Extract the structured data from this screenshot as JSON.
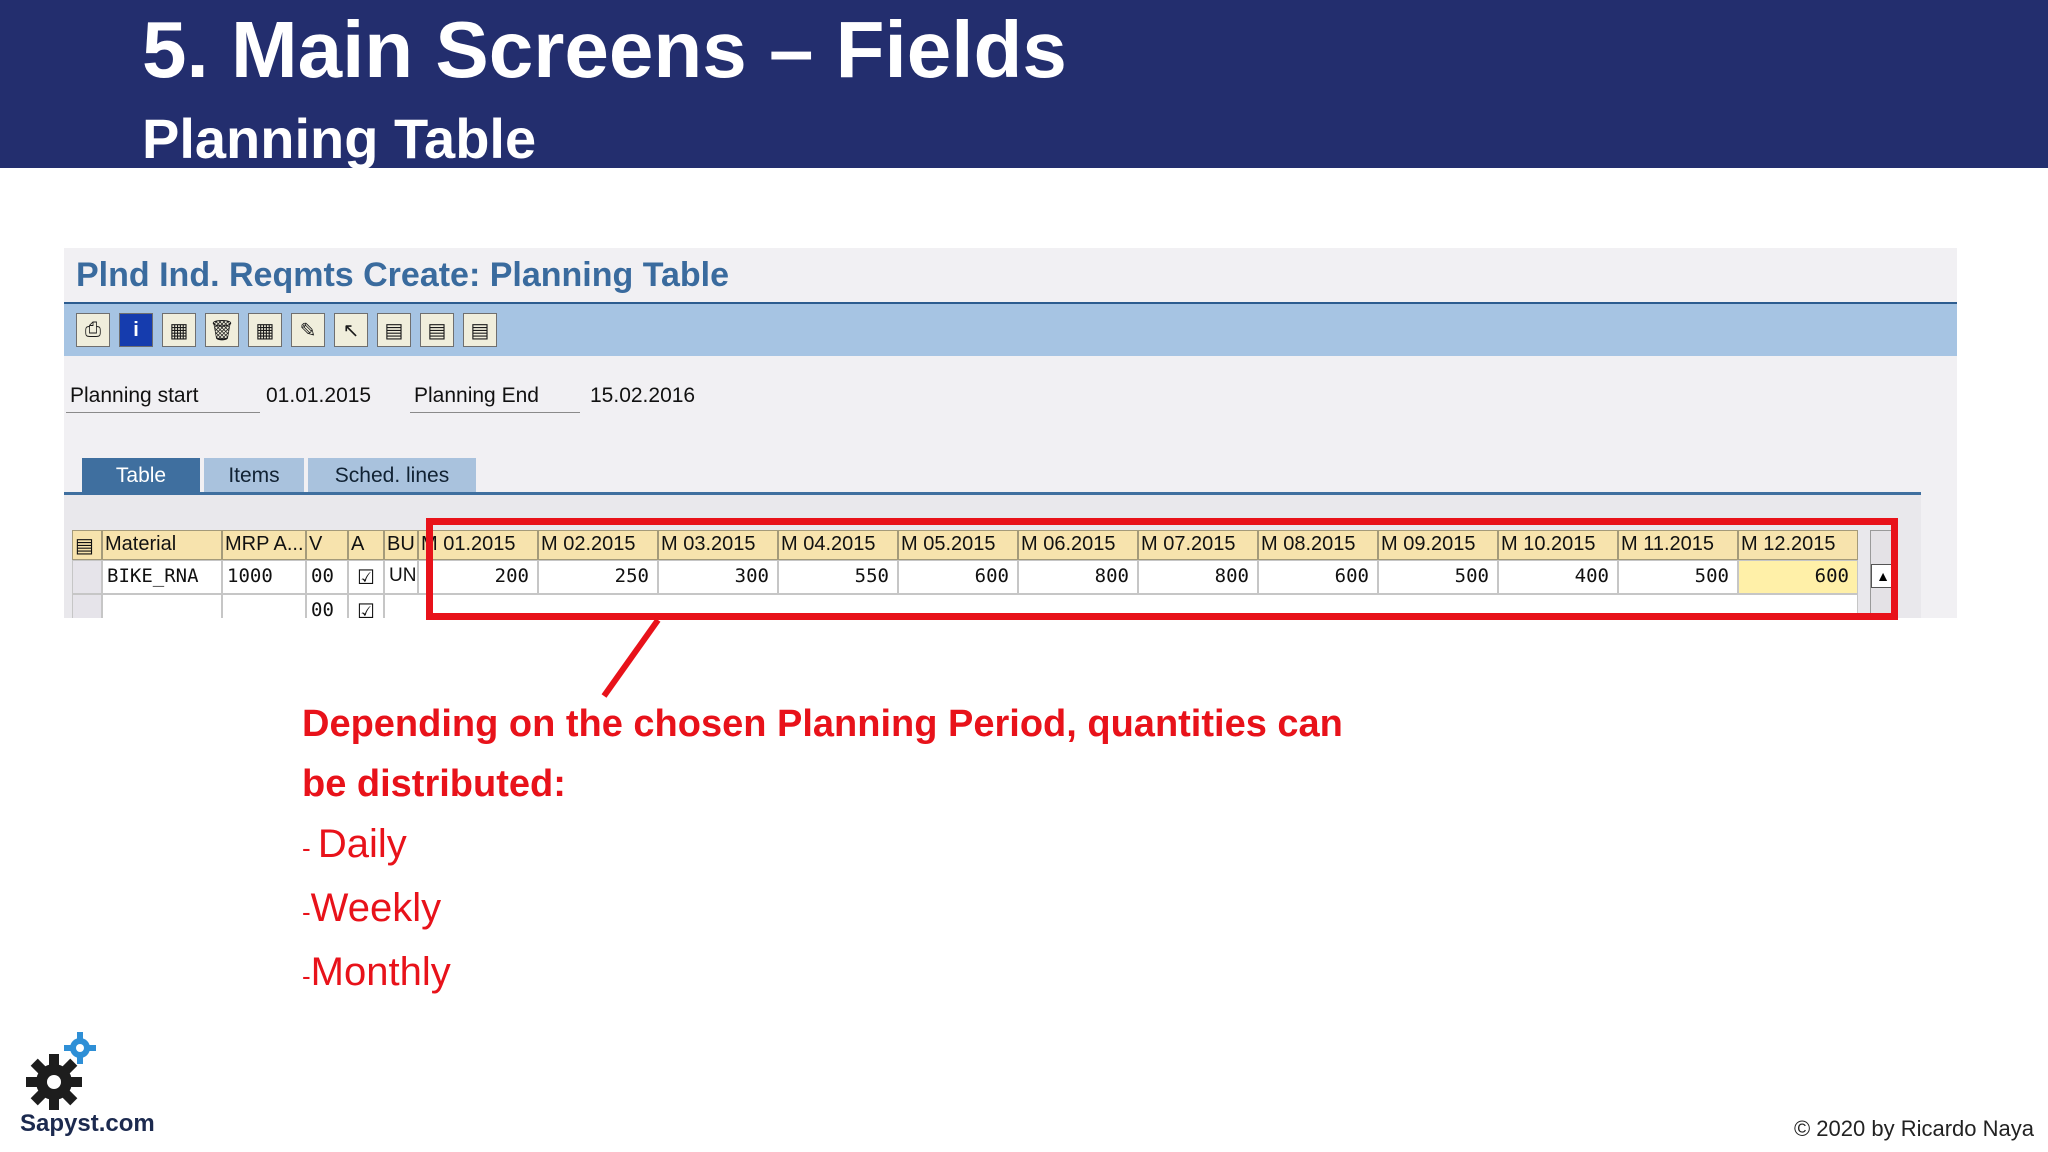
{
  "slide": {
    "title": "5. Main Screens – Fields",
    "subtitle": "Planning Table"
  },
  "sap_screen": {
    "title": "Plnd Ind. Reqmts Create: Planning Table",
    "toolbar_icons": [
      "print-icon",
      "info-icon",
      "group-icon",
      "delete-icon",
      "table-layout-icon",
      "edit-icon",
      "select-cursor-icon",
      "select-all-icon",
      "deselect-all-icon",
      "details-icon"
    ],
    "planning_start_label": "Planning start",
    "planning_start_value": "01.01.2015",
    "planning_end_label": "Planning End",
    "planning_end_value": "15.02.2016",
    "tabs": [
      {
        "label": "Table",
        "active": true
      },
      {
        "label": "Items",
        "active": false
      },
      {
        "label": "Sched. lines",
        "active": false
      }
    ],
    "table": {
      "headers": [
        "Material",
        "MRP A...",
        "V",
        "A",
        "BU",
        "M 01.2015",
        "M 02.2015",
        "M 03.2015",
        "M 04.2015",
        "M 05.2015",
        "M 06.2015",
        "M 07.2015",
        "M 08.2015",
        "M 09.2015",
        "M 10.2015",
        "M 11.2015",
        "M 12.2015"
      ],
      "row1": {
        "material": "BIKE_RNA",
        "mrp_area": "1000",
        "version": "00",
        "active": true,
        "bun": "UN",
        "quantities": [
          "200",
          "250",
          "300",
          "550",
          "600",
          "800",
          "800",
          "600",
          "500",
          "400",
          "500",
          "600"
        ]
      },
      "row2": {
        "version": "00",
        "active": true
      }
    }
  },
  "callout": {
    "line1": "Depending on the chosen Planning Period, quantities can",
    "line2": "be distributed:",
    "options": [
      {
        "dash": "- ",
        "label": "Daily"
      },
      {
        "dash": "-",
        "label": "Weekly"
      },
      {
        "dash": "-",
        "label": "Monthly"
      }
    ]
  },
  "footer": {
    "logo_text": "Sapyst.com",
    "copyright": "© 2020 by Ricardo Naya"
  },
  "colors": {
    "banner": "#232e6e",
    "accent_red": "#e8121a",
    "sap_title": "#3a6b9e",
    "header_cell": "#f7e3ad",
    "highlight_cell": "#fff0a8"
  }
}
